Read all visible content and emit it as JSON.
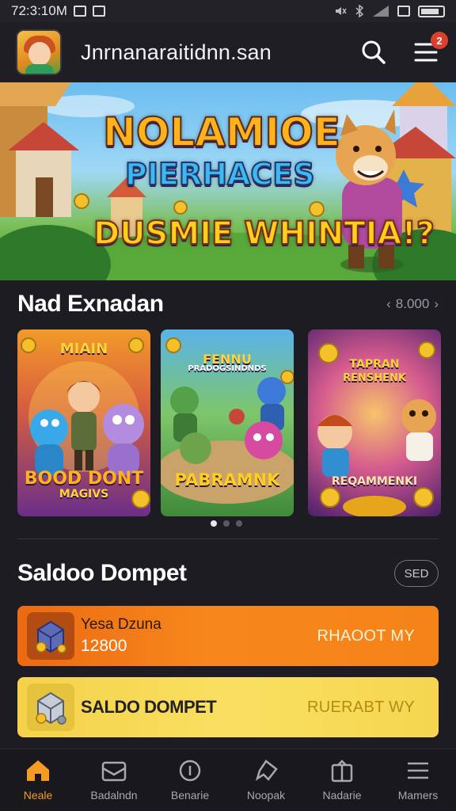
{
  "status_bar": {
    "time": "72:3:10M"
  },
  "header": {
    "title": "Jnrnanaraitidnn.san",
    "notification_count": "2"
  },
  "hero": {
    "line1": "NOLAMIOE",
    "line2": "PIERHACES",
    "line3": "DUSMIE WHINTIA!?"
  },
  "featured": {
    "title": "Nad Exnadan",
    "pager": "8.000",
    "cards": [
      {
        "top": "MIAIN",
        "bottom": "BOOD DONT",
        "sub": "MAGIVS"
      },
      {
        "top": "FENNU",
        "bottom": "PABRAMNK",
        "sub": "PRADOGSINDNDS"
      },
      {
        "top": "TAPRAN",
        "bottom": "REQAMMENKI",
        "sub": "RENSHENK"
      }
    ]
  },
  "wallet": {
    "title": "Saldoo Dompet",
    "see_all": "SED",
    "rows": [
      {
        "label": "Yesa Dzuna",
        "value": "12800",
        "action": "RHAOOT MY"
      },
      {
        "title": "SALDO DOMPET",
        "action": "RUERABT WY"
      }
    ]
  },
  "bottom_nav": [
    {
      "label": "Neale",
      "icon": "home-icon"
    },
    {
      "label": "Badalndn",
      "icon": "box-icon"
    },
    {
      "label": "Benarie",
      "icon": "coin-icon"
    },
    {
      "label": "Noopak",
      "icon": "chat-icon"
    },
    {
      "label": "Nadarie",
      "icon": "gift-icon"
    },
    {
      "label": "Mamers",
      "icon": "menu-icon"
    }
  ],
  "colors": {
    "accent": "#f59b23",
    "orange_row": "#f27a17",
    "yellow_row": "#f7d955",
    "background": "#1d1c22"
  }
}
